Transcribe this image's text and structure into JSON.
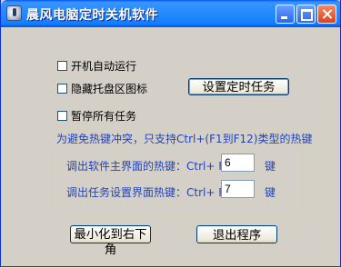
{
  "window": {
    "title": "晨风电脑定时关机软件"
  },
  "options": {
    "autostart_label": "开机自动运行",
    "hide_tray_label": "隐藏托盘区图标",
    "pause_all_label": "暂停所有任务"
  },
  "buttons": {
    "set_task": "设置定时任务",
    "minimize_corner": "最小化到右下角",
    "exit": "退出程序"
  },
  "hotkeys": {
    "title": "为避免热键冲突，只支持Ctrl+(F1到F12)类型的热键",
    "main_label": "调出软件主界面的热键：Ctrl+ F",
    "main_value": "6",
    "task_label": "调出任务设置界面热键：Ctrl+ F",
    "task_value": "7",
    "suffix": "键"
  }
}
